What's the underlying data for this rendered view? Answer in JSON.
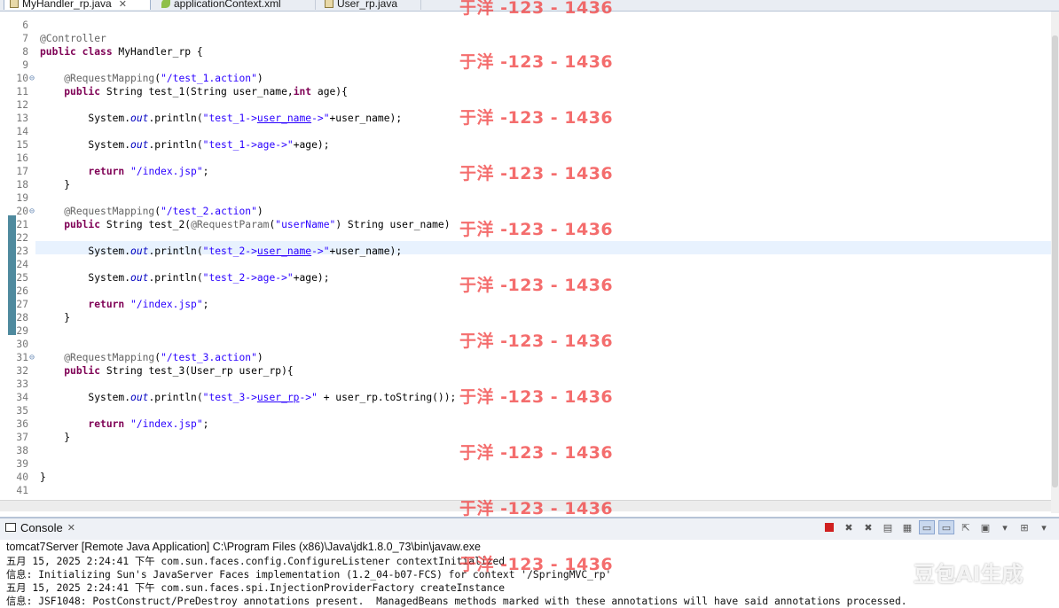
{
  "tabs": [
    {
      "label": "MyHandler_rp.java",
      "close": "✕"
    },
    {
      "label": "applicationContext.xml"
    },
    {
      "label": "User_rp.java"
    }
  ],
  "editor": {
    "lines": [
      {
        "n": "6",
        "fold": "",
        "html": ""
      },
      {
        "n": "7",
        "fold": "",
        "html": "<span class='an'>@Controller</span>"
      },
      {
        "n": "8",
        "fold": "",
        "html": "<span class='kw'>public class</span> MyHandler_rp {"
      },
      {
        "n": "9",
        "fold": "",
        "html": ""
      },
      {
        "n": "10",
        "fold": "⊖",
        "html": "    <span class='an'>@RequestMapping</span>(<span class='st'>\"/test_1.action\"</span>)"
      },
      {
        "n": "11",
        "fold": "",
        "html": "    <span class='kw'>public</span> String test_1(String user_name,<span class='kw'>int</span> age){"
      },
      {
        "n": "12",
        "fold": "",
        "html": ""
      },
      {
        "n": "13",
        "fold": "",
        "html": "        System.<span class='it'>out</span>.println(<span class='st'>\"test_1-&gt;</span><span class='st-u'>user_name</span><span class='st'>-&gt;\"</span>+user_name);"
      },
      {
        "n": "14",
        "fold": "",
        "html": ""
      },
      {
        "n": "15",
        "fold": "",
        "html": "        System.<span class='it'>out</span>.println(<span class='st'>\"test_1-&gt;age-&gt;\"</span>+age);"
      },
      {
        "n": "16",
        "fold": "",
        "html": ""
      },
      {
        "n": "17",
        "fold": "",
        "html": "        <span class='kw'>return</span> <span class='st'>\"/index.jsp\"</span>;"
      },
      {
        "n": "18",
        "fold": "",
        "html": "    }"
      },
      {
        "n": "19",
        "fold": "",
        "html": ""
      },
      {
        "n": "20",
        "fold": "⊖",
        "html": "    <span class='an'>@RequestMapping</span>(<span class='st'>\"/test_2.action\"</span>)"
      },
      {
        "n": "21",
        "fold": "",
        "html": "    <span class='kw'>public</span> String test_2(<span class='an'>@RequestParam</span>(<span class='st'>\"userName\"</span>) String user_name)"
      },
      {
        "n": "22",
        "fold": "",
        "html": ""
      },
      {
        "n": "23",
        "fold": "",
        "html": "        System.<span class='it'>out</span>.println(<span class='st'>\"test_2-&gt;</span><span class='st-u'>user_name</span><span class='st'>-&gt;\"</span>+user_name);"
      },
      {
        "n": "24",
        "fold": "",
        "html": ""
      },
      {
        "n": "25",
        "fold": "",
        "html": "        System.<span class='it'>out</span>.println(<span class='st'>\"test_2-&gt;age-&gt;\"</span>+age);"
      },
      {
        "n": "26",
        "fold": "",
        "html": ""
      },
      {
        "n": "27",
        "fold": "",
        "html": "        <span class='kw'>return</span> <span class='st'>\"/index.jsp\"</span>;"
      },
      {
        "n": "28",
        "fold": "",
        "html": "    }"
      },
      {
        "n": "29",
        "fold": "",
        "html": ""
      },
      {
        "n": "30",
        "fold": "",
        "html": ""
      },
      {
        "n": "31",
        "fold": "⊖",
        "html": "    <span class='an'>@RequestMapping</span>(<span class='st'>\"/test_3.action\"</span>)"
      },
      {
        "n": "32",
        "fold": "",
        "html": "    <span class='kw'>public</span> String test_3(User_rp user_rp){"
      },
      {
        "n": "33",
        "fold": "",
        "html": ""
      },
      {
        "n": "34",
        "fold": "",
        "html": "        System.<span class='it'>out</span>.println(<span class='st'>\"test_3-&gt;</span><span class='st-u'>user_rp</span><span class='st'>-&gt;\"</span> + user_rp.toString());"
      },
      {
        "n": "35",
        "fold": "",
        "html": ""
      },
      {
        "n": "36",
        "fold": "",
        "html": "        <span class='kw'>return</span> <span class='st'>\"/index.jsp\"</span>;"
      },
      {
        "n": "37",
        "fold": "",
        "html": "    }"
      },
      {
        "n": "38",
        "fold": "",
        "html": ""
      },
      {
        "n": "39",
        "fold": "",
        "html": ""
      },
      {
        "n": "40",
        "fold": "",
        "html": "}"
      },
      {
        "n": "41",
        "fold": "",
        "html": ""
      }
    ]
  },
  "console": {
    "tab_label": "Console",
    "tab_close": "✕",
    "server": "tomcat7Server [Remote Java Application] C:\\Program Files (x86)\\Java\\jdk1.8.0_73\\bin\\javaw.exe",
    "logs": [
      "五月 15, 2025 2:24:41 下午 com.sun.faces.config.ConfigureListener contextInitialized",
      "信息: Initializing Sun's JavaServer Faces implementation (1.2_04-b07-FCS) for context '/SpringMVC_rp'",
      "五月 15, 2025 2:24:41 下午 com.sun.faces.spi.InjectionProviderFactory createInstance",
      "信息: JSF1048: PostConstruct/PreDestroy annotations present.  ManagedBeans methods marked with these annotations will have said annotations processed."
    ],
    "toolbar_icons": [
      "terminate-icon",
      "remove-launch-icon",
      "remove-all-icon",
      "clear-console-icon",
      "scroll-lock-icon",
      "show-on-stdout-icon",
      "show-on-stderr-icon",
      "pin-console-icon",
      "display-console-icon",
      "dropdown-icon",
      "open-console-icon",
      "dropdown-icon",
      "minimize-icon",
      "maximize-icon"
    ]
  },
  "watermark": {
    "text": "于洋 -123 - 1436",
    "ai_label": "豆包AI生成"
  }
}
